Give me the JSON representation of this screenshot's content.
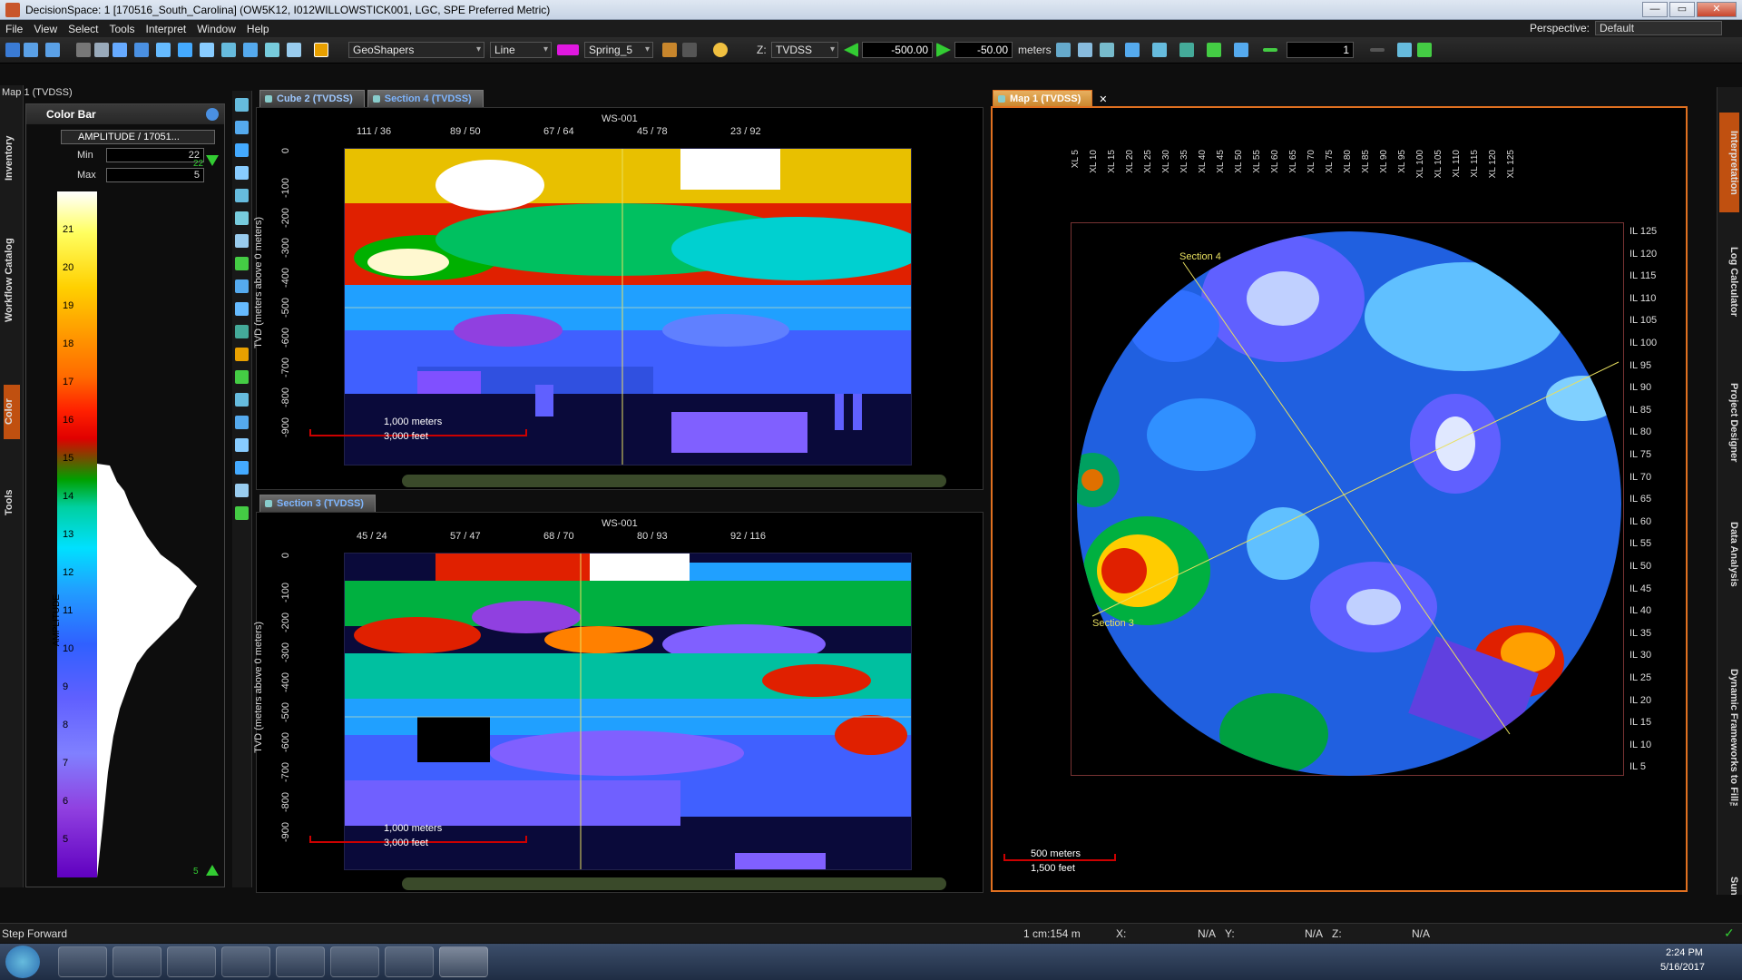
{
  "window": {
    "title": "DecisionSpace: 1 [170516_South_Carolina] (OW5K12, I012WILLOWSTICK001, LGC, SPE Preferred Metric)",
    "min": "—",
    "max": "▭",
    "close": "✕"
  },
  "menu": {
    "items": [
      "File",
      "View",
      "Select",
      "Tools",
      "Interpret",
      "Window",
      "Help"
    ],
    "perspective_label": "Perspective:",
    "perspective_value": "Default"
  },
  "toolbar": {
    "geoshapers": "GeoShapers",
    "line_style": "Line",
    "color_name": "Spring_5",
    "z_label": "Z:",
    "z_domain": "TVDSS",
    "z_value_1": "-500.00",
    "z_value_2": "-50.00",
    "units": "meters",
    "count": "1"
  },
  "left_panel": {
    "title": "Map 1 (TVDSS)",
    "colorbar_title": "Color Bar",
    "attribute": "AMPLITUDE / 17051...",
    "min_label": "Min",
    "min_value": "22",
    "max_label": "Max",
    "max_value": "5",
    "axis_label": "AMPLITUDE",
    "ticks": [
      "21",
      "20",
      "19",
      "18",
      "17",
      "16",
      "15",
      "14",
      "13",
      "12",
      "11",
      "10",
      "9",
      "8",
      "7",
      "6",
      "5"
    ],
    "top_marker": "22",
    "bottom_marker": "5"
  },
  "left_dock_tabs": [
    "Inventory",
    "Workflow Catalog",
    "Color",
    "Tools"
  ],
  "section4": {
    "tabs": [
      "Cube 2 (TVDSS)",
      "Section 4 (TVDSS)"
    ],
    "well": "WS-001",
    "x_ticks": [
      "111 / 36",
      "89 / 50",
      "67 / 64",
      "45 / 78",
      "23 / 92"
    ],
    "y_label": "TVD (meters above 0 meters)",
    "y_ticks": [
      "0",
      "-100",
      "-200",
      "-300",
      "-400",
      "-500",
      "-600",
      "-700",
      "-800",
      "-900"
    ],
    "scale_m": "1,000 meters",
    "scale_ft": "3,000 feet"
  },
  "section3": {
    "tabs": [
      "Section 3 (TVDSS)"
    ],
    "well": "WS-001",
    "x_ticks": [
      "45 / 24",
      "57 / 47",
      "68 / 70",
      "80 / 93",
      "92 / 116"
    ],
    "y_label": "TVD (meters above 0 meters)",
    "y_ticks": [
      "0",
      "-100",
      "-200",
      "-300",
      "-400",
      "-500",
      "-600",
      "-700",
      "-800",
      "-900"
    ],
    "scale_m": "1,000 meters",
    "scale_ft": "3,000 feet"
  },
  "map1": {
    "tab": "Map 1 (TVDSS)",
    "close": "✕",
    "xl_labels": [
      "XL 5",
      "XL 10",
      "XL 15",
      "XL 20",
      "XL 25",
      "XL 30",
      "XL 35",
      "XL 40",
      "XL 45",
      "XL 50",
      "XL 55",
      "XL 60",
      "XL 65",
      "XL 70",
      "XL 75",
      "XL 80",
      "XL 85",
      "XL 90",
      "XL 95",
      "XL 100",
      "XL 105",
      "XL 110",
      "XL 115",
      "XL 120",
      "XL 125"
    ],
    "il_labels": [
      "IL 125",
      "IL 120",
      "IL 115",
      "IL 110",
      "IL 105",
      "IL 100",
      "IL 95",
      "IL 90",
      "IL 85",
      "IL 80",
      "IL 75",
      "IL 70",
      "IL 65",
      "IL 60",
      "IL 55",
      "IL 50",
      "IL 45",
      "IL 40",
      "IL 35",
      "IL 30",
      "IL 25",
      "IL 20",
      "IL 15",
      "IL 10",
      "IL 5"
    ],
    "section4_label": "Section 4",
    "section3_label": "Section 3",
    "scale_m": "500 meters",
    "scale_ft": "1,500 feet"
  },
  "right_dock_tabs": [
    "Interpretation",
    "Log Calculator",
    "Project Designer",
    "Data Analysis",
    "Dynamic Frameworks to Fill™",
    "Sun"
  ],
  "status": {
    "message": "Step Forward",
    "scale": "1 cm:154 m",
    "x_label": "X:",
    "x_value": "N/A",
    "y_label": "Y:",
    "y_value": "N/A",
    "z_label": "Z:",
    "z_value": "N/A"
  },
  "taskbar": {
    "time": "2:24 PM",
    "date": "5/16/2017"
  },
  "colors": {
    "accent": "#e07020",
    "tab_text": "#7fb6ff",
    "scale_bar": "#cc0000",
    "section_line": "#e8e060"
  }
}
